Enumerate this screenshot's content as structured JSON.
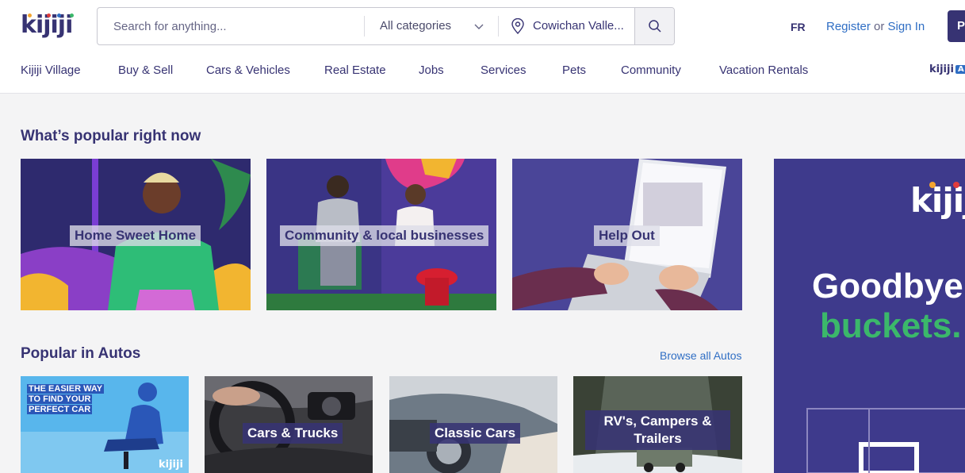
{
  "header": {
    "logo_text": "kijiji",
    "search": {
      "placeholder": "Search for anything...",
      "value": ""
    },
    "category": "All categories",
    "location": "Cowichan Valle...",
    "language": "FR",
    "register_label": "Register",
    "or_label": "or",
    "sign_in_label": "Sign In",
    "post_label": "P"
  },
  "nav": {
    "items": [
      "Kijiji Village",
      "Buy & Sell",
      "Cars & Vehicles",
      "Real Estate",
      "Jobs",
      "Services",
      "Pets",
      "Community",
      "Vacation Rentals"
    ],
    "autos_logo": "kijiji",
    "autos_badge": "A"
  },
  "popular": {
    "title": "What’s popular right now",
    "cards": [
      "Home Sweet Home",
      "Community & local businesses",
      "Help Out"
    ]
  },
  "autos": {
    "title": "Popular in Autos",
    "browse_label": "Browse all Autos",
    "promo_lines": [
      "THE EASIER WAY",
      "TO FIND YOUR",
      "PERFECT CAR"
    ],
    "promo_logo": "kijiji",
    "cards": [
      "Cars & Trucks",
      "Classic Cars",
      "RV's, Campers &",
      "Trailers"
    ]
  },
  "ad": {
    "logo": "kijiji",
    "line1": "Goodbye",
    "line2": "buckets."
  },
  "colors": {
    "brand": "#373373",
    "link": "#2f6ec4",
    "accent_green": "#3bb86a",
    "background": "#f4f4f5"
  }
}
